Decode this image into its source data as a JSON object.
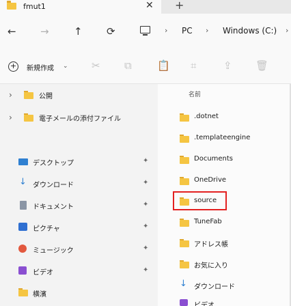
{
  "tab": {
    "title": "fmut1",
    "close": "✕",
    "new_tab": "+"
  },
  "nav": {
    "back": "←",
    "forward": "→",
    "up": "↑",
    "refresh": "⟳"
  },
  "breadcrumb": {
    "items": [
      "PC",
      "Windows (C:)"
    ],
    "separator": "›",
    "overflow": "›"
  },
  "command_bar": {
    "new_label": "新規作成",
    "new_chevron": "⌄",
    "icons": {
      "cut": "✂",
      "copy": "⧉",
      "paste": "📋",
      "rename": "⌗",
      "share": "⇪",
      "delete": "🗑"
    }
  },
  "sidebar": {
    "tree": [
      {
        "label": "公開"
      },
      {
        "label": "電子メールの添付ファイル"
      }
    ],
    "quick": [
      {
        "label": "デスクトップ",
        "icon": "desktop-icon"
      },
      {
        "label": "ダウンロード",
        "icon": "download-icon"
      },
      {
        "label": "ドキュメント",
        "icon": "document-icon"
      },
      {
        "label": "ピクチャ",
        "icon": "picture-icon"
      },
      {
        "label": "ミュージック",
        "icon": "music-icon"
      },
      {
        "label": "ビデオ",
        "icon": "video-icon"
      },
      {
        "label": "横濱",
        "icon": "folder-icon"
      }
    ],
    "pin_glyph": "✦"
  },
  "files": {
    "column_header": "名前",
    "items": [
      {
        "name": ".dotnet",
        "icon": "folder-icon"
      },
      {
        "name": ".templateengine",
        "icon": "folder-icon"
      },
      {
        "name": "Documents",
        "icon": "folder-icon"
      },
      {
        "name": "OneDrive",
        "icon": "folder-icon"
      },
      {
        "name": "source",
        "icon": "folder-icon",
        "highlighted": true
      },
      {
        "name": "TuneFab",
        "icon": "folder-icon"
      },
      {
        "name": "アドレス帳",
        "icon": "folder-icon"
      },
      {
        "name": "お気に入り",
        "icon": "folder-icon"
      },
      {
        "name": "ダウンロード",
        "icon": "download-icon"
      },
      {
        "name": "ビデオ",
        "icon": "video-icon"
      }
    ]
  },
  "colors": {
    "highlight": "#e32020",
    "folder": "#f5c542"
  }
}
